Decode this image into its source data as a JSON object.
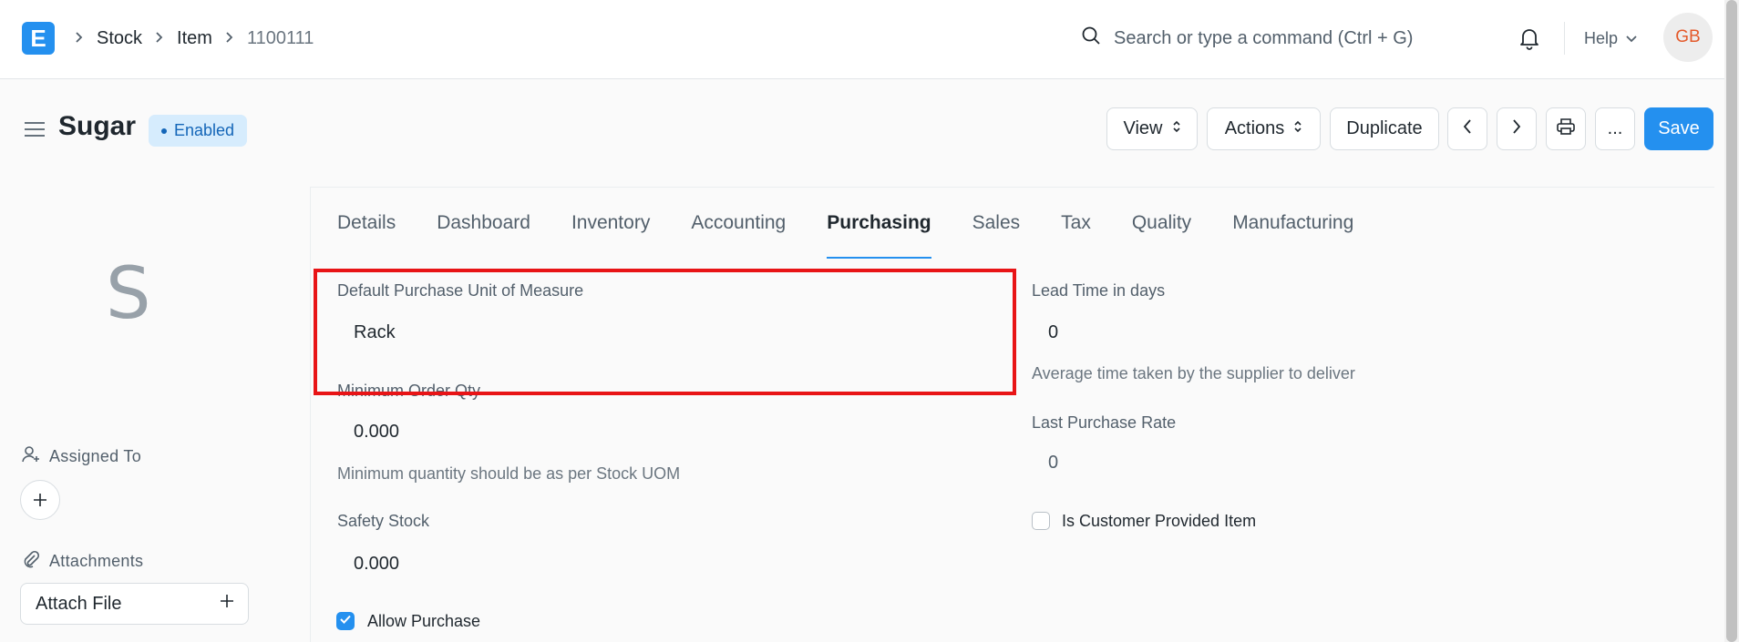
{
  "navbar": {
    "logo_letter": "E",
    "breadcrumbs": [
      "Stock",
      "Item",
      "1100111"
    ],
    "search_placeholder": "Search or type a command (Ctrl + G)",
    "help_label": "Help",
    "avatar_initials": "GB"
  },
  "header": {
    "title": "Sugar",
    "status": "Enabled",
    "buttons": {
      "view": "View",
      "actions": "Actions",
      "duplicate": "Duplicate",
      "more": "...",
      "save": "Save"
    }
  },
  "sidebar": {
    "initial": "S",
    "assigned_to_label": "Assigned To",
    "attachments_label": "Attachments",
    "attach_file_label": "Attach File"
  },
  "tabs": [
    {
      "label": "Details"
    },
    {
      "label": "Dashboard"
    },
    {
      "label": "Inventory"
    },
    {
      "label": "Accounting"
    },
    {
      "label": "Purchasing",
      "active": true
    },
    {
      "label": "Sales"
    },
    {
      "label": "Tax"
    },
    {
      "label": "Quality"
    },
    {
      "label": "Manufacturing"
    }
  ],
  "form": {
    "default_purchase_uom": {
      "label": "Default Purchase Unit of Measure",
      "value": "Rack"
    },
    "min_order_qty": {
      "label": "Minimum Order Qty",
      "value": "0.000",
      "description": "Minimum quantity should be as per Stock UOM"
    },
    "safety_stock": {
      "label": "Safety Stock",
      "value": "0.000"
    },
    "allow_purchase": {
      "label": "Allow Purchase",
      "checked": true
    },
    "lead_time": {
      "label": "Lead Time in days",
      "value": "0",
      "description": "Average time taken by the supplier to deliver"
    },
    "last_purchase_rate": {
      "label": "Last Purchase Rate",
      "value": "0"
    },
    "is_customer_provided": {
      "label": "Is Customer Provided Item",
      "checked": false
    }
  },
  "colors": {
    "accent": "#2490ef",
    "highlight": "#e81416",
    "badge_bg": "#d6ecfd"
  }
}
